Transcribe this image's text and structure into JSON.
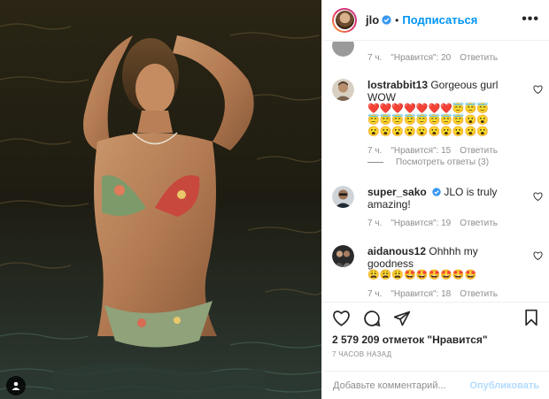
{
  "header": {
    "username": "jlo",
    "separator": "•",
    "follow_label": "Подписаться",
    "more_label": "•••"
  },
  "comments": [
    {
      "id": "partial",
      "meta": {
        "time": "7 ч.",
        "likes": "\"Нравится\": 20",
        "reply": "Ответить"
      }
    },
    {
      "id": "lostrabbit",
      "username": "lostrabbit13",
      "text": " Gorgeous gurl WOW",
      "emoji_lines": [
        "❤️❤️❤️❤️❤️❤️❤️😇😇😇",
        "😇😇😇😇😇😇😇😇😮😮",
        "😮😮😮😮😮😮😮😮😮😮"
      ],
      "meta": {
        "time": "7 ч.",
        "likes": "\"Нравится\": 15",
        "reply": "Ответить"
      },
      "view_replies": "Посмотреть ответы (3)"
    },
    {
      "id": "super_sako",
      "username": "super_sako",
      "text": " JLO is truly amazing!",
      "meta": {
        "time": "7 ч.",
        "likes": "\"Нравится\": 19",
        "reply": "Ответить"
      }
    },
    {
      "id": "aidanous",
      "username": "aidanous12",
      "text": " Ohhhh my goodness",
      "emoji_lines": [
        "😩😩😩🤩🤩🤩🤩🤩🤩"
      ],
      "meta": {
        "time": "7 ч.",
        "likes": "\"Нравится\": 18",
        "reply": "Ответить"
      }
    }
  ],
  "actions": {
    "likes_count": "2 579 209 отметок \"Нравится\"",
    "time_ago": "7 ЧАСОВ НАЗАД"
  },
  "add_comment": {
    "placeholder": "Добавьте комментарий...",
    "publish_label": "Опубликовать"
  },
  "colors": {
    "accent": "#0095f6",
    "publish_disabled": "#b3dbff",
    "secondary_text": "#8e8e8e",
    "verified": "#3897f0",
    "heart_red": "#e0245e"
  },
  "icons": [
    "verified-badge-icon",
    "more-options-icon",
    "small-heart-icon",
    "heart-icon",
    "comment-icon",
    "share-icon",
    "bookmark-icon",
    "user-tag-icon"
  ]
}
